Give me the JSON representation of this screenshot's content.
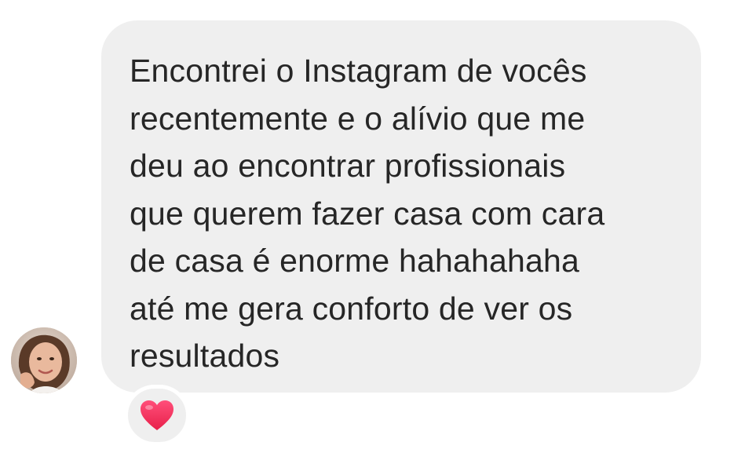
{
  "message": {
    "text": "Encontrei o Instagram de vocês\nrecentemente e o alívio que me\ndeu ao encontrar profissionais\nque querem fazer casa com cara\nde casa é enorme hahahahaha\naté me gera conforto de ver os\nresultados"
  },
  "reaction": {
    "icon": "heart-icon",
    "color": "#f0305a"
  },
  "colors": {
    "bubble": "#efefef",
    "text": "#262626",
    "background": "#ffffff"
  }
}
